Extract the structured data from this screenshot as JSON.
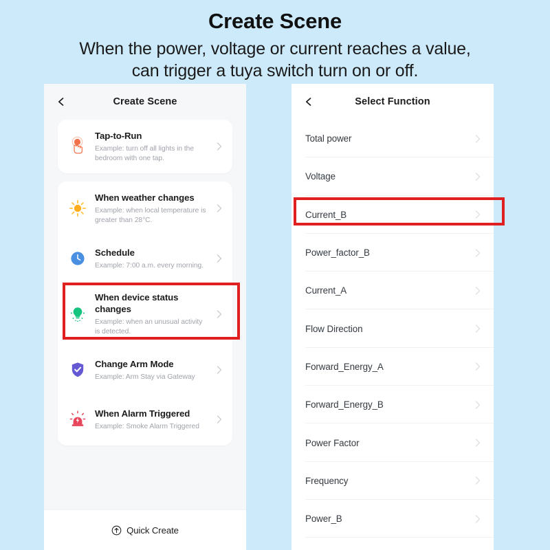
{
  "banner": {
    "title": "Create Scene",
    "line1": "When the power, voltage or current reaches a value,",
    "line2": "can trigger a tuya switch turn on or off."
  },
  "colors": {
    "page_background": "#cdeafb",
    "panel_background": "#f6f7f9",
    "card_background": "#ffffff",
    "highlight_red": "#e01f20",
    "title_text": "#1c1c1e",
    "desc_text": "#a0a3ab",
    "list_text": "#343a40",
    "icon_tap_to_run": "#f4724b",
    "icon_weather": "#ffb300",
    "icon_schedule": "#4a90e2",
    "icon_device_status": "#16c47f",
    "icon_arm_mode": "#6558d3",
    "icon_alarm": "#e8455a"
  },
  "left_panel": {
    "header": {
      "back_icon": "chevron-left-icon",
      "title": "Create Scene"
    },
    "cards": [
      {
        "rows": [
          {
            "icon": "tap-to-run-icon",
            "title": "Tap-to-Run",
            "desc": "Example: turn off all lights in the bedroom with one tap.",
            "chevron": "chevron-right-icon"
          }
        ]
      },
      {
        "rows": [
          {
            "icon": "sun-icon",
            "title": "When weather changes",
            "desc": "Example: when local temperature is greater than 28°C.",
            "chevron": "chevron-right-icon"
          },
          {
            "icon": "clock-icon",
            "title": "Schedule",
            "desc": "Example: 7:00 a.m. every morning.",
            "chevron": "chevron-right-icon"
          },
          {
            "icon": "light-bulb-icon",
            "title": "When device status changes",
            "desc": "Example: when an unusual activity is detected.",
            "chevron": "chevron-right-icon",
            "highlighted": true
          },
          {
            "icon": "shield-check-icon",
            "title": "Change Arm Mode",
            "desc": "Example: Arm Stay via Gateway",
            "chevron": "chevron-right-icon"
          },
          {
            "icon": "alarm-siren-icon",
            "title": "When Alarm Triggered",
            "desc": "Example: Smoke Alarm Triggered",
            "chevron": "chevron-right-icon"
          }
        ]
      }
    ],
    "quick_create": {
      "icon": "arrow-up-circle-icon",
      "label": "Quick Create"
    }
  },
  "right_panel": {
    "header": {
      "back_icon": "chevron-left-icon",
      "title": "Select Function"
    },
    "functions": [
      {
        "label": "Total power",
        "chevron": "chevron-right-icon"
      },
      {
        "label": "Voltage",
        "chevron": "chevron-right-icon"
      },
      {
        "label": "Current_B",
        "chevron": "chevron-right-icon",
        "highlighted": true
      },
      {
        "label": "Power_factor_B",
        "chevron": "chevron-right-icon"
      },
      {
        "label": "Current_A",
        "chevron": "chevron-right-icon"
      },
      {
        "label": "Flow Direction",
        "chevron": "chevron-right-icon"
      },
      {
        "label": "Forward_Energy_A",
        "chevron": "chevron-right-icon"
      },
      {
        "label": "Forward_Energy_B",
        "chevron": "chevron-right-icon"
      },
      {
        "label": "Power Factor",
        "chevron": "chevron-right-icon"
      },
      {
        "label": "Frequency",
        "chevron": "chevron-right-icon"
      },
      {
        "label": "Power_B",
        "chevron": "chevron-right-icon"
      }
    ]
  }
}
